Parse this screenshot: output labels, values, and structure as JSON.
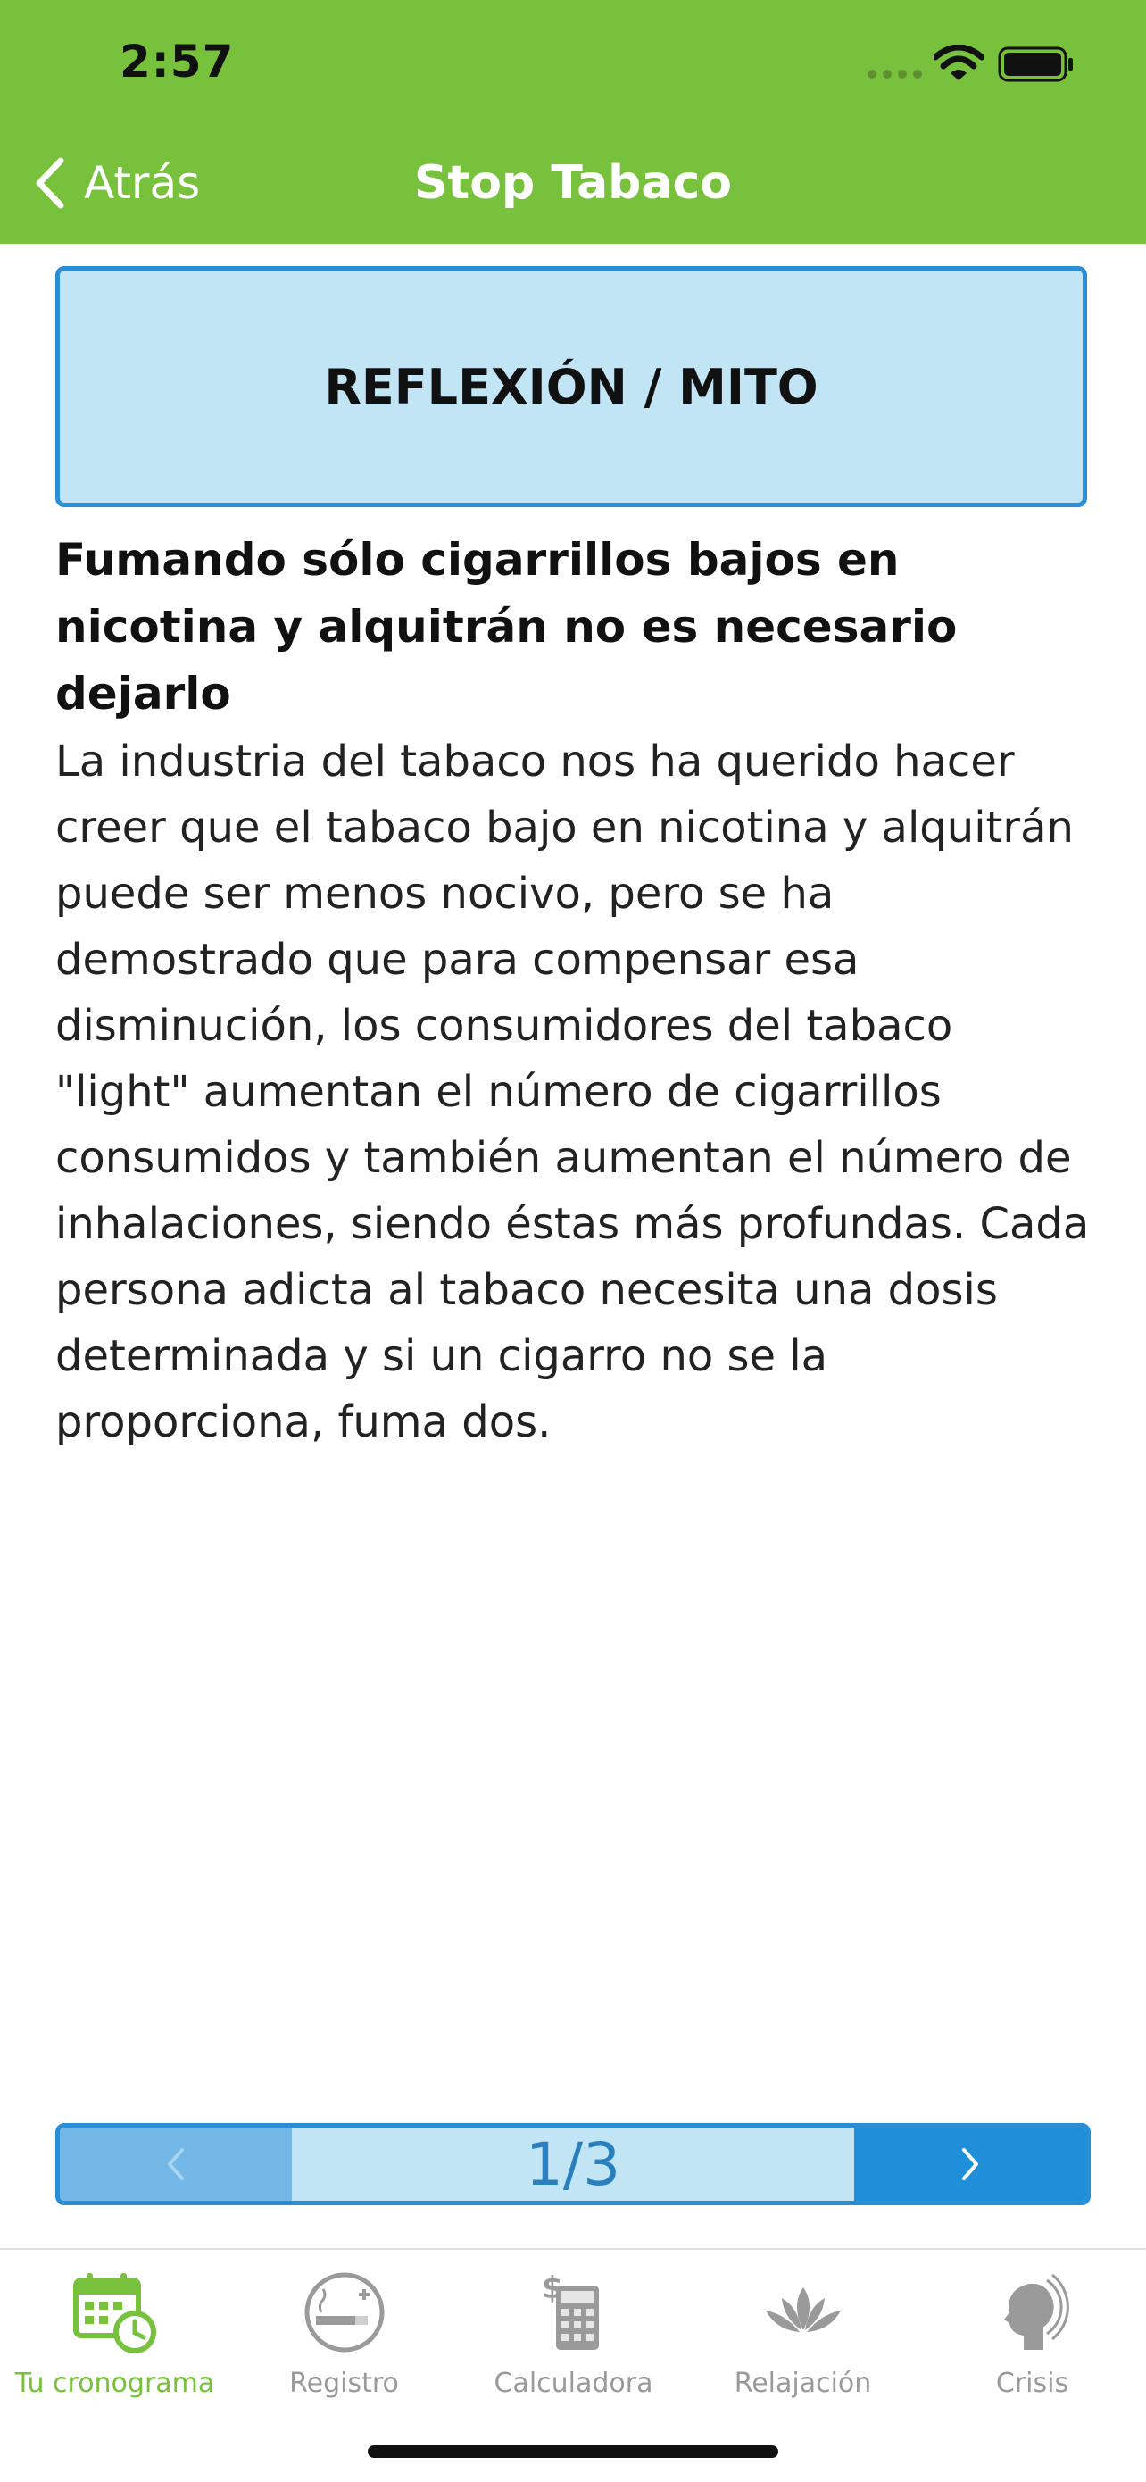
{
  "status_bar": {
    "time": "2:57"
  },
  "nav": {
    "back_label": "Atrás",
    "title": "Stop Tabaco"
  },
  "content": {
    "section_label": "REFLEXIÓN / MITO",
    "myth_title": "Fumando sólo cigarrillos bajos en nicotina y alquitrán no es necesario dejarlo",
    "myth_body": "La industria del tabaco nos ha querido hacer creer que el tabaco bajo en nicotina y alquitrán puede ser menos nocivo, pero se ha demostrado que para compensar esa disminución, los consumidores del tabaco \"light\" aumentan el número de cigarrillos consumidos y también aumentan el número de inhalaciones, siendo éstas más profundas. Cada persona adicta al tabaco necesita una dosis determinada y si un cigarro no se la proporciona, fuma dos."
  },
  "pager": {
    "counter": "1/3",
    "current": 1,
    "total": 3
  },
  "tabs": [
    {
      "label": "Tu cronograma",
      "icon": "calendar-clock-icon",
      "active": true
    },
    {
      "label": "Registro",
      "icon": "cigarette-plus-icon",
      "active": false
    },
    {
      "label": "Calculadora",
      "icon": "calculator-dollar-icon",
      "active": false
    },
    {
      "label": "Relajación",
      "icon": "lotus-icon",
      "active": false
    },
    {
      "label": "Crisis",
      "icon": "head-waves-icon",
      "active": false
    }
  ],
  "colors": {
    "header_green": "#78c13c",
    "banner_blue": "#c2e5f6",
    "border_blue": "#2a8ed6",
    "pager_next_blue": "#1e8fd8",
    "pager_prev_blue": "#73b8e6",
    "tab_inactive": "#9a9a9a"
  }
}
